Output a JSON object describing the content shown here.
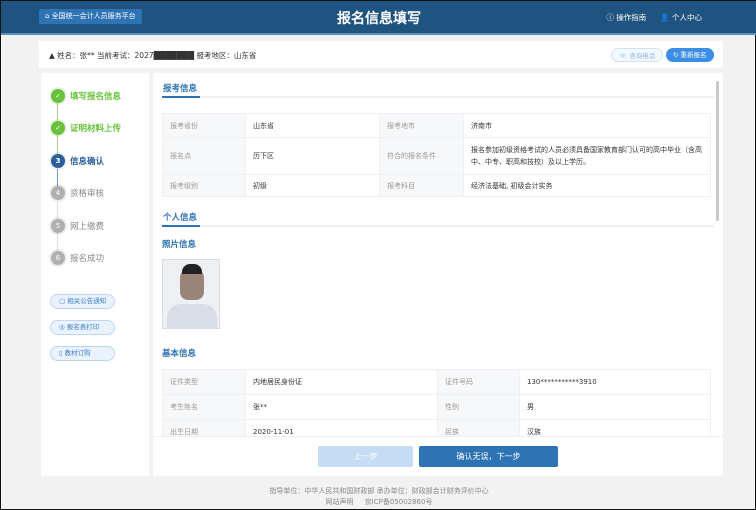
{
  "header": {
    "home_label": "全国统一会计人员服务平台",
    "title": "报名信息填写",
    "guide": "操作指南",
    "user_center": "个人中心"
  },
  "infobar": {
    "text": "姓名：张**   当前考试：2027███████ 报考地区：山东省",
    "consult": "咨询电话",
    "reregister": "重新报名"
  },
  "steps": [
    {
      "num": "✓",
      "label": "填写报名信息",
      "state": "done"
    },
    {
      "num": "✓",
      "label": "证明材料上传",
      "state": "done"
    },
    {
      "num": "3",
      "label": "信息确认",
      "state": "active"
    },
    {
      "num": "4",
      "label": "资格审核",
      "state": "pending"
    },
    {
      "num": "5",
      "label": "网上缴费",
      "state": "pending"
    },
    {
      "num": "6",
      "label": "报名成功",
      "state": "pending"
    }
  ],
  "side_buttons": [
    "相关公告通知",
    "报名表打印",
    "教材订购"
  ],
  "exam_info": {
    "title": "报考信息",
    "rows": [
      [
        "报考省份",
        "山东省",
        "报考地市",
        "济南市"
      ],
      [
        "报名点",
        "历下区",
        "符合的报名条件",
        "报名参加初级资格考试的人员必须具备国家教育部门认可的高中毕业（含高中、中专、职高和技校）及以上学历。"
      ],
      [
        "报考级别",
        "初级",
        "报考科目",
        "经济法基础, 初级会计实务"
      ]
    ]
  },
  "personal": {
    "title": "个人信息",
    "photo_title": "照片信息",
    "basic_title": "基本信息",
    "rows": [
      [
        "证件类型",
        "内地居民身份证",
        "证件号码",
        "130***********3910"
      ],
      [
        "考生姓名",
        "张**",
        "性别",
        "男"
      ],
      [
        "出生日期",
        "2020-11-01",
        "民族",
        "汉族"
      ]
    ]
  },
  "buttons": {
    "prev": "上一步",
    "next": "确认无误，下一步"
  },
  "footer": {
    "line1": "指导单位：中华人民共和国财政部      承办单位：财政部会计财务评价中心",
    "statement": "网站声明",
    "icp": "京ICP备05002860号"
  },
  "colors": {
    "header": "#1f5380",
    "accent": "#2e74b5",
    "done": "#67c23a"
  }
}
